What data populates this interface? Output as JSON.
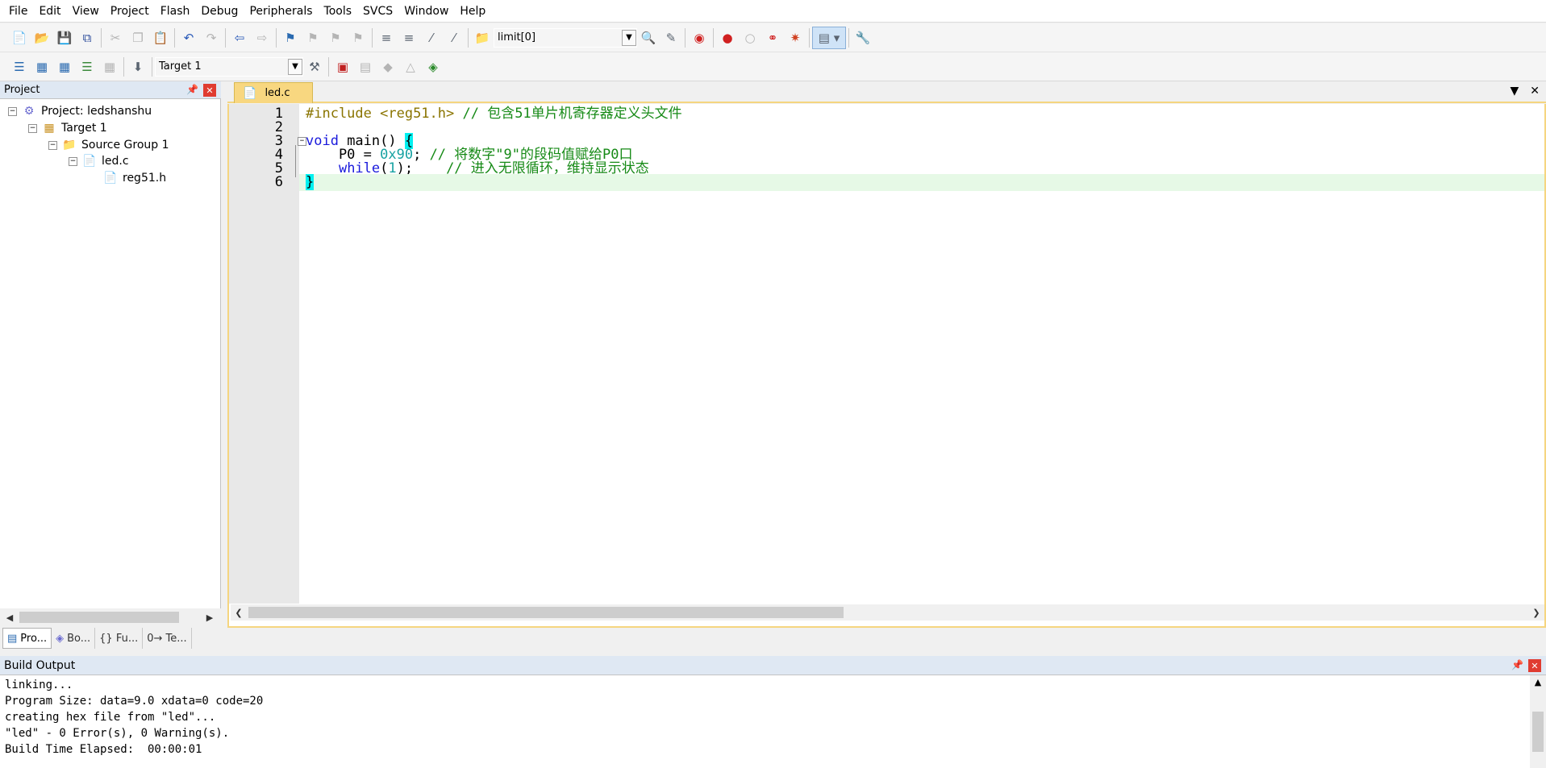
{
  "menu": [
    "File",
    "Edit",
    "View",
    "Project",
    "Flash",
    "Debug",
    "Peripherals",
    "Tools",
    "SVCS",
    "Window",
    "Help"
  ],
  "toolbar": {
    "find_combo_value": "limit[0]",
    "target_combo_value": "Target 1"
  },
  "project_panel": {
    "title": "Project",
    "tree": {
      "project": "Project: ledshanshu",
      "target": "Target 1",
      "group": "Source Group 1",
      "file": "led.c",
      "header": "reg51.h"
    },
    "tabs": [
      "Pro...",
      "Bo...",
      "{} Fu...",
      "0→ Te..."
    ]
  },
  "editor": {
    "tab_label": "led.c",
    "line_numbers": [
      "1",
      "2",
      "3",
      "4",
      "5",
      "6"
    ],
    "line1": {
      "pp": "#include",
      "inc": " <reg51.h>",
      "cm": " // 包含51单片机寄存器定义头文件"
    },
    "line3": {
      "kw": "void",
      "rest": " main() ",
      "br": "{"
    },
    "line4": {
      "pre": "    P0 = ",
      "num": "0x90",
      "semi": ";",
      "cm": " // 将数字\"9\"的段码值赋给P0口"
    },
    "line5": {
      "pre": "    ",
      "kw": "while",
      "open": "(",
      "num": "1",
      "close": ");",
      "cm": "    // 进入无限循环，维持显示状态"
    },
    "line6": {
      "br": "}"
    }
  },
  "build_output": {
    "title": "Build Output",
    "lines": [
      "linking...",
      "Program Size: data=9.0 xdata=0 code=20",
      "creating hex file from \"led\"...",
      "\"led\" - 0 Error(s), 0 Warning(s).",
      "Build Time Elapsed:  00:00:01"
    ]
  },
  "colors": {
    "accent_tab": "#f8d780",
    "keyword": "#1a1adc",
    "comment": "#168a16",
    "number": "#17a2a2",
    "preprocessor": "#8a7400",
    "current_line": "#e6f9e6"
  }
}
